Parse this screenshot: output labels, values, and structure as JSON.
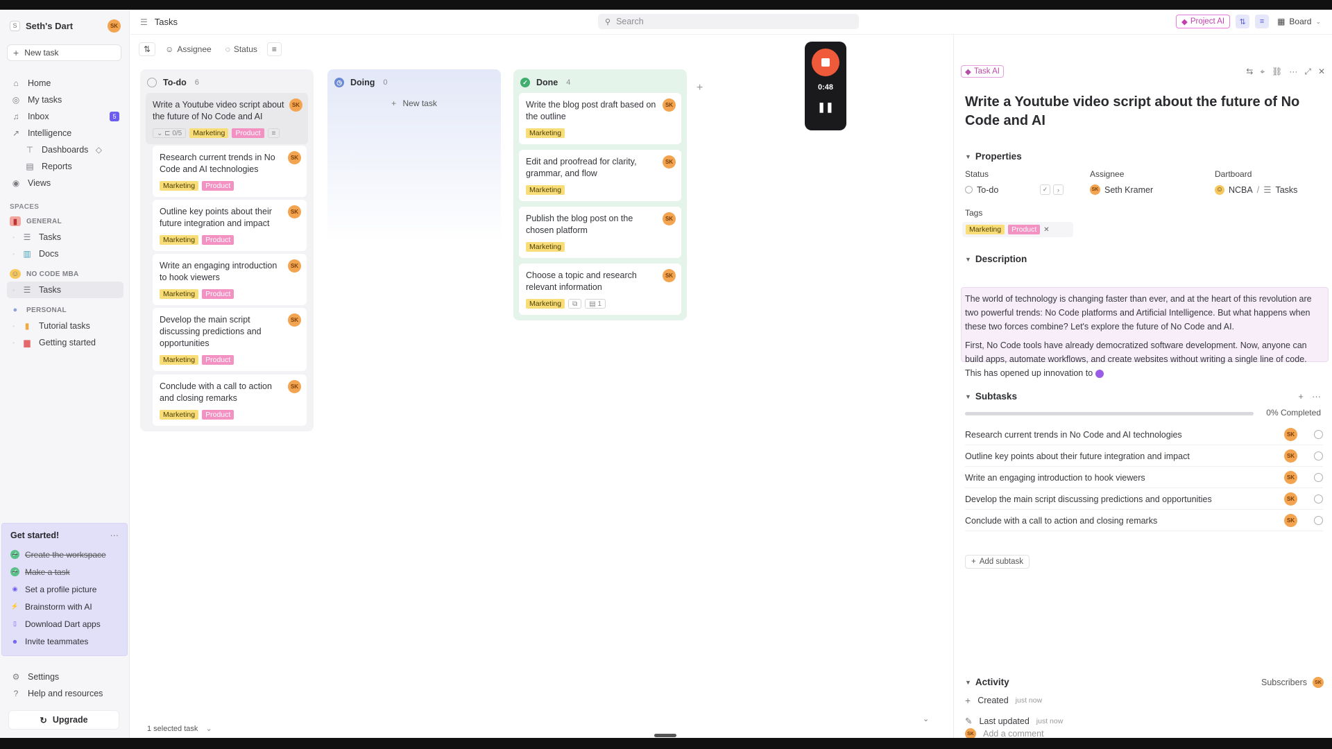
{
  "workspace": {
    "name": "Seth's Dart",
    "logo": "S",
    "avatar": "SK"
  },
  "sidebar": {
    "new_task": "New task",
    "nav": [
      {
        "label": "Home",
        "icon": "home-icon"
      },
      {
        "label": "My tasks",
        "icon": "target-icon"
      },
      {
        "label": "Inbox",
        "icon": "bell-icon",
        "badge": "5"
      },
      {
        "label": "Intelligence",
        "icon": "chart-icon"
      }
    ],
    "intelligence_sub": [
      {
        "label": "Dashboards"
      },
      {
        "label": "Reports"
      }
    ],
    "views": "Views",
    "spaces_label": "SPACES",
    "general": {
      "name": "GENERAL",
      "items": [
        "Tasks",
        "Docs"
      ]
    },
    "nocode": {
      "name": "NO CODE MBA",
      "items": [
        "Tasks"
      ]
    },
    "personal": {
      "name": "PERSONAL",
      "items": [
        "Tutorial tasks",
        "Getting started"
      ]
    },
    "get_started": {
      "title": "Get started!",
      "items": [
        {
          "label": "Create the workspace",
          "done": true
        },
        {
          "label": "Make a task",
          "done": true
        },
        {
          "label": "Set a profile picture",
          "done": false
        },
        {
          "label": "Brainstorm with AI",
          "done": false
        },
        {
          "label": "Download Dart apps",
          "done": false
        },
        {
          "label": "Invite teammates",
          "done": false
        }
      ]
    },
    "settings": "Settings",
    "help": "Help and resources",
    "upgrade": "Upgrade"
  },
  "header": {
    "title": "Tasks",
    "search_placeholder": "Search",
    "project_ai": "Project AI",
    "board": "Board"
  },
  "toolbar": {
    "assignee": "Assignee",
    "status": "Status"
  },
  "board": {
    "todo": {
      "name": "To-do",
      "count": "6",
      "cards": [
        {
          "title": "Write a Youtube video script about the future of No Code and AI",
          "subtasks": "0/5",
          "tags": [
            "Marketing",
            "Product"
          ]
        },
        {
          "title": "Research current trends in No Code and AI technologies",
          "tags": [
            "Marketing",
            "Product"
          ]
        },
        {
          "title": "Outline key points about their future integration and impact",
          "tags": [
            "Marketing",
            "Product"
          ]
        },
        {
          "title": "Write an engaging introduction to hook viewers",
          "tags": [
            "Marketing",
            "Product"
          ]
        },
        {
          "title": "Develop the main script discussing predictions and opportunities",
          "tags": [
            "Marketing",
            "Product"
          ]
        },
        {
          "title": "Conclude with a call to action and closing remarks",
          "tags": [
            "Marketing",
            "Product"
          ]
        }
      ]
    },
    "doing": {
      "name": "Doing",
      "count": "0",
      "new_task": "New task"
    },
    "done": {
      "name": "Done",
      "count": "4",
      "cards": [
        {
          "title": "Write the blog post draft based on the outline",
          "tags": [
            "Marketing"
          ]
        },
        {
          "title": "Edit and proofread for clarity, grammar, and flow",
          "tags": [
            "Marketing"
          ]
        },
        {
          "title": "Publish the blog post on the chosen platform",
          "tags": [
            "Marketing"
          ]
        },
        {
          "title": "Choose a topic and research relevant information",
          "tags": [
            "Marketing"
          ],
          "docs": "1"
        }
      ]
    },
    "avatar": "SK"
  },
  "recorder": {
    "time": "0:48"
  },
  "footer": {
    "selected": "1 selected task"
  },
  "detail": {
    "task_ai": "Task AI",
    "title": "Write a Youtube video script about the future of No Code and AI",
    "properties_label": "Properties",
    "status_label": "Status",
    "status_value": "To-do",
    "assignee_label": "Assignee",
    "assignee_value": "Seth Kramer",
    "dartboard_label": "Dartboard",
    "dartboard_value": "NCBA",
    "dartboard_sep": "/",
    "dartboard_tasks": "Tasks",
    "tags_label": "Tags",
    "tags": [
      "Marketing",
      "Product"
    ],
    "description_label": "Description",
    "description_p1": "The world of technology is changing faster than ever, and at the heart of this revolution are two powerful trends: No Code platforms and Artificial Intelligence. But what happens when these two forces combine? Let's explore the future of No Code and AI.",
    "description_p2": "First, No Code tools have already democratized software development. Now, anyone can build apps, automate workflows, and create websites without writing a single line of code. This has opened up innovation to",
    "subtasks_label": "Subtasks",
    "completed": "0% Completed",
    "progress": 0,
    "subtasks": [
      "Research current trends in No Code and AI technologies",
      "Outline key points about their future integration and impact",
      "Write an engaging introduction to hook viewers",
      "Develop the main script discussing predictions and opportunities",
      "Conclude with a call to action and closing remarks"
    ],
    "add_subtask": "Add subtask",
    "activity_label": "Activity",
    "subscribers": "Subscribers",
    "created": "Created",
    "created_ts": "just now",
    "updated": "Last updated",
    "updated_ts": "just now",
    "comment_placeholder": "Add a comment"
  },
  "colors": {
    "accent": "#6d5cf0",
    "marketing": "#f8dd79",
    "product": "#f291c2",
    "done": "#5bbf8a",
    "record": "#ef5a3b"
  }
}
